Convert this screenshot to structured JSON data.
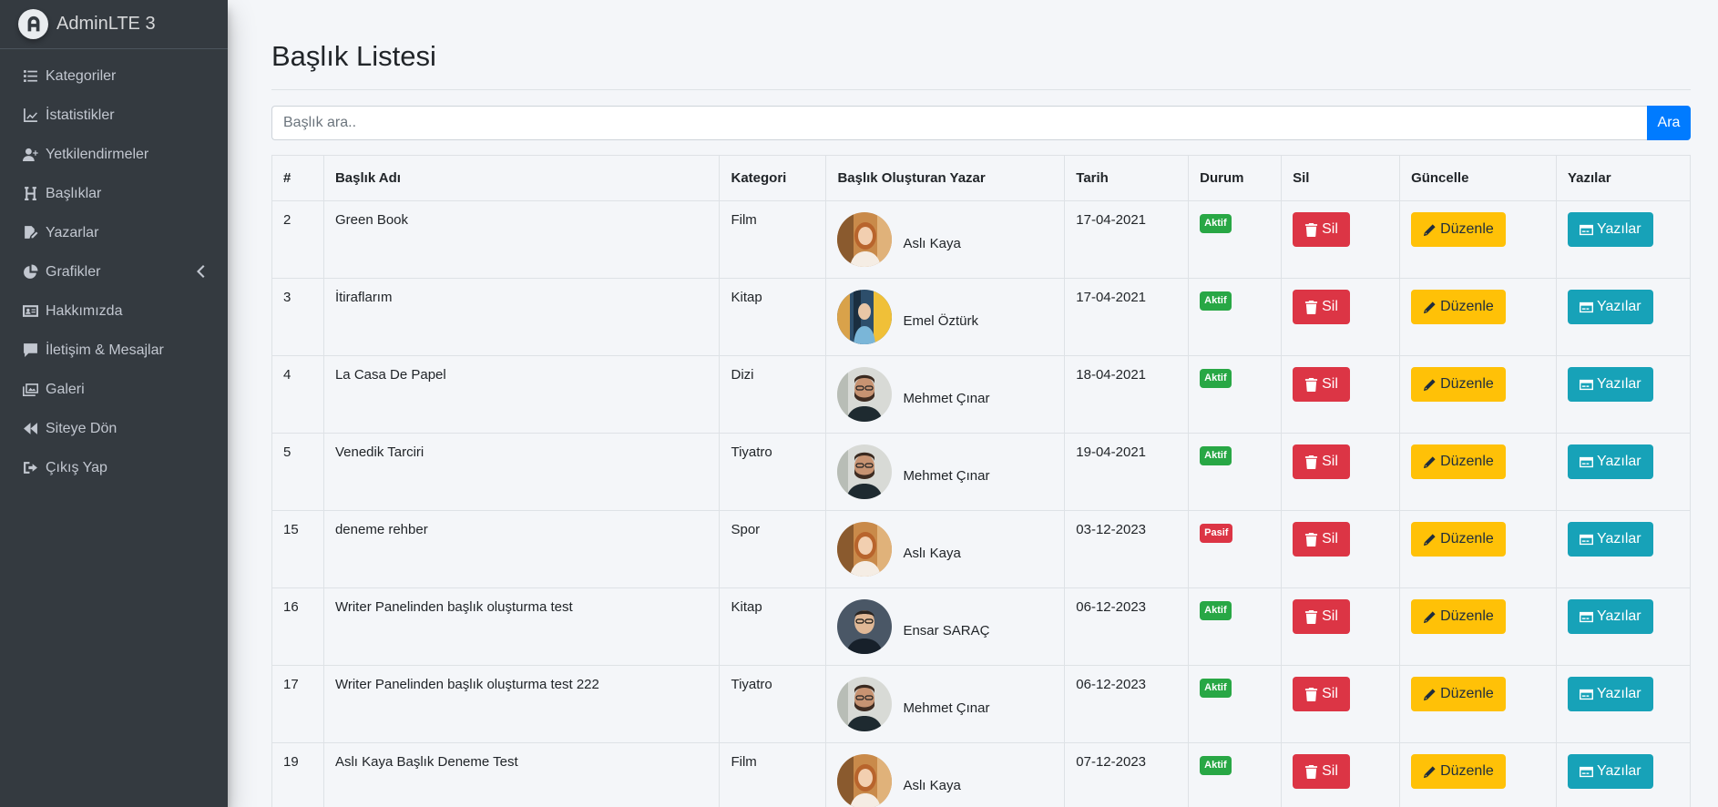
{
  "brand": {
    "name": "AdminLTE 3"
  },
  "sidebar": {
    "items": [
      {
        "label": "Kategoriler",
        "icon": "list-icon"
      },
      {
        "label": "İstatistikler",
        "icon": "chart-line-icon"
      },
      {
        "label": "Yetkilendirmeler",
        "icon": "user-plus-icon"
      },
      {
        "label": "Başlıklar",
        "icon": "heading-icon"
      },
      {
        "label": "Yazarlar",
        "icon": "file-signature-icon"
      },
      {
        "label": "Grafikler",
        "icon": "chart-pie-icon"
      },
      {
        "label": "Hakkımızda",
        "icon": "id-card-icon"
      },
      {
        "label": "İletişim & Mesajlar",
        "icon": "comment-icon"
      },
      {
        "label": "Galeri",
        "icon": "images-icon"
      },
      {
        "label": "Siteye Dön",
        "icon": "backward-icon"
      },
      {
        "label": "Çıkış Yap",
        "icon": "sign-out-icon"
      }
    ]
  },
  "page": {
    "title": "Başlık Listesi"
  },
  "search": {
    "placeholder": "Başlık ara..",
    "button": "Ara"
  },
  "table": {
    "headers": [
      "#",
      "Başlık Adı",
      "Kategori",
      "Başlık Oluşturan Yazar",
      "Tarih",
      "Durum",
      "Sil",
      "Güncelle",
      "Yazılar"
    ],
    "rows": [
      {
        "id": "2",
        "name": "Green Book",
        "category": "Film",
        "author": "Aslı Kaya",
        "date": "17-04-2021",
        "status": "Aktif"
      },
      {
        "id": "3",
        "name": "İtiraflarım",
        "category": "Kitap",
        "author": "Emel Öztürk",
        "date": "17-04-2021",
        "status": "Aktif"
      },
      {
        "id": "4",
        "name": "La Casa De Papel",
        "category": "Dizi",
        "author": "Mehmet Çınar",
        "date": "18-04-2021",
        "status": "Aktif"
      },
      {
        "id": "5",
        "name": "Venedik Tarciri",
        "category": "Tiyatro",
        "author": "Mehmet Çınar",
        "date": "19-04-2021",
        "status": "Aktif"
      },
      {
        "id": "15",
        "name": "deneme rehber",
        "category": "Spor",
        "author": "Aslı Kaya",
        "date": "03-12-2023",
        "status": "Pasif"
      },
      {
        "id": "16",
        "name": "Writer Panelinden başlık oluşturma test",
        "category": "Kitap",
        "author": "Ensar SARAÇ",
        "date": "06-12-2023",
        "status": "Aktif"
      },
      {
        "id": "17",
        "name": "Writer Panelinden başlık oluşturma test 222",
        "category": "Tiyatro",
        "author": "Mehmet Çınar",
        "date": "06-12-2023",
        "status": "Aktif"
      },
      {
        "id": "19",
        "name": "Aslı Kaya Başlık Deneme Test",
        "category": "Film",
        "author": "Aslı Kaya",
        "date": "07-12-2023",
        "status": "Aktif"
      }
    ],
    "actions": {
      "delete": "Sil",
      "edit": "Düzenle",
      "posts": "Yazılar"
    }
  },
  "colors": {
    "sidebar": "#343a40",
    "primary": "#007bff",
    "success": "#28a745",
    "danger": "#dc3545",
    "warning": "#ffc107",
    "info": "#17a2b8"
  }
}
